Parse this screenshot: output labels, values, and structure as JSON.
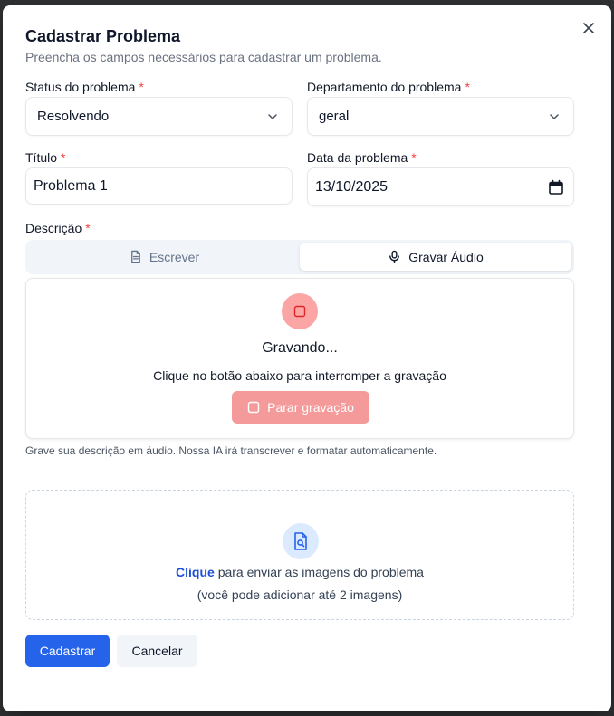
{
  "dialog": {
    "title": "Cadastrar Problema",
    "subtitle": "Preencha os campos necessários para cadastrar um problema."
  },
  "fields": {
    "status": {
      "label": "Status do problema",
      "required": "*",
      "value": "Resolvendo"
    },
    "department": {
      "label": "Departamento do problema",
      "required": "*",
      "value": "geral"
    },
    "title": {
      "label": "Título",
      "required": "*",
      "value": "Problema 1"
    },
    "date": {
      "label": "Data da problema",
      "required": "*",
      "value": "13/10/2025"
    },
    "description": {
      "label": "Descrição",
      "required": "*"
    }
  },
  "tabs": [
    {
      "label": "Escrever",
      "icon": "document-icon",
      "active": false
    },
    {
      "label": "Gravar Áudio",
      "icon": "microphone-icon",
      "active": true
    }
  ],
  "recording": {
    "status": "Gravando...",
    "hint": "Clique no botão abaixo para interromper a gravação",
    "stop_label": "Parar gravação",
    "help": "Grave sua descrição em áudio. Nossa IA irá transcrever e formatar automaticamente."
  },
  "upload": {
    "click": "Clique",
    "middle": " para enviar as imagens do ",
    "link": "problema",
    "limit": "(você pode adicionar até 2 imagens)"
  },
  "actions": {
    "submit": "Cadastrar",
    "cancel": "Cancelar"
  },
  "colors": {
    "primary": "#2563eb",
    "required": "#ef4444",
    "recording": "#fca5a5",
    "stop_button": "#f59a9a"
  }
}
